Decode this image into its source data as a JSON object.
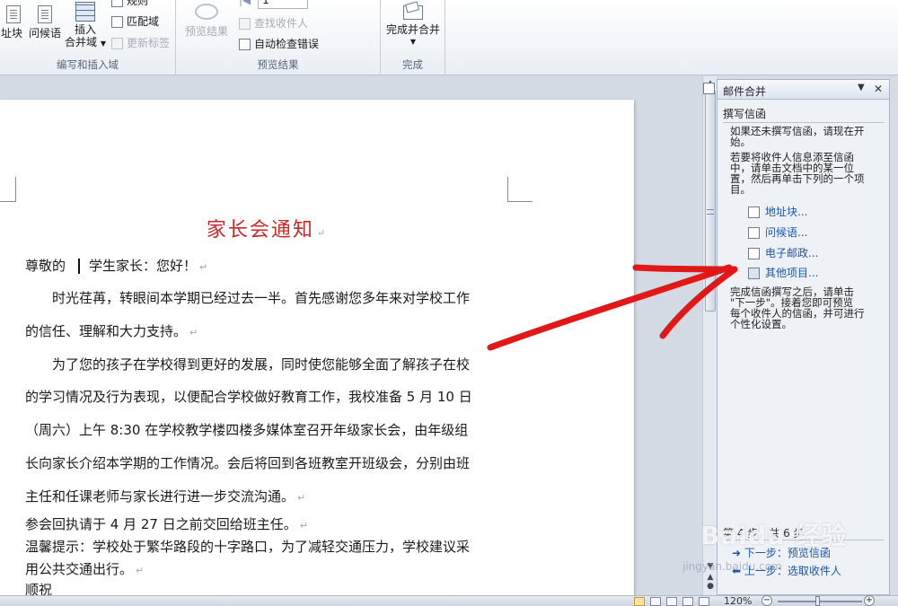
{
  "ribbon": {
    "group_write_insert": {
      "title": "编写和插入域",
      "address_block": "址块",
      "greeting": "问候语",
      "insert_field": "插入",
      "insert_field_line2": "合并域",
      "rules": "规则",
      "match_fields": "匹配域",
      "update_labels": "更新标签"
    },
    "group_preview": {
      "title": "预览结果",
      "preview_results": "预览结果",
      "record_number": "1",
      "find_recipient": "查找收件人",
      "auto_check_errors": "自动检查错误"
    },
    "group_finish": {
      "title": "完成",
      "finish_merge": "完成并合并"
    }
  },
  "document": {
    "title": "家长会通知",
    "salutation_prefix": "尊敬的",
    "salutation_suffix": "学生家长：您好！",
    "lines": [
      "时光荏苒，转眼间本学期已经过去一半。首先感谢您多年来对学校工作",
      "的信任、理解和大力支持。",
      "为了您的孩子在学校得到更好的发展，同时使您能够全面了解孩子在校",
      "的学习情况及行为表现，以便配合学校做好教育工作，我校准备 5 月 10 日",
      "（周六）上午  8:30  在学校教学楼四楼多媒体室召开年级家长会，由年级组",
      "长向家长介绍本学期的工作情况。会后将回到各班教室开班级会，分别由班",
      "主任和任课老师与家长进行进一步交流沟通。",
      "参会回执请于 4 月 27 日之前交回给班主任。",
      "温馨提示：学校处于繁华路段的十字路口，为了减轻交通压力，学校建议采",
      "用公共交通出行。",
      "顺祝"
    ],
    "paragraph_mark": "↵"
  },
  "task_pane": {
    "title": "邮件合并",
    "section_heading": "撰写信函",
    "intro_text_1": "如果还未撰写信函，请现在开",
    "intro_text_2": "始。",
    "intro_text_3": "若要将收件人信息添至信函",
    "intro_text_4": "中，请单击文档中的某一位",
    "intro_text_5": "置，然后再单击下列的一个项",
    "intro_text_6": "目。",
    "links": [
      {
        "label": "地址块...",
        "icon": "address-block-icon"
      },
      {
        "label": "问候语...",
        "icon": "greeting-icon"
      },
      {
        "label": "电子邮政...",
        "icon": "electronic-postage-icon"
      },
      {
        "label": "其他项目...",
        "icon": "more-items-icon"
      }
    ],
    "after_text_1": "完成信函撰写之后，请单击",
    "after_text_2": "\"下一步\"。接着您即可预览",
    "after_text_3": "每个收件人的信函，并可进行",
    "after_text_4": "个性化设置。",
    "step_text": "第 4 步，共 6 步",
    "next_step": "下一步：预览信函",
    "prev_step": "上一步：选取收件人"
  },
  "status_bar": {
    "zoom": "120%"
  },
  "watermark": {
    "brand": "Baidu 经验",
    "url": "jingyan.baidu.com"
  },
  "colors": {
    "title_red": "#cc2a2a",
    "annotation_red": "#e01818",
    "link_blue": "#1b55a8"
  }
}
